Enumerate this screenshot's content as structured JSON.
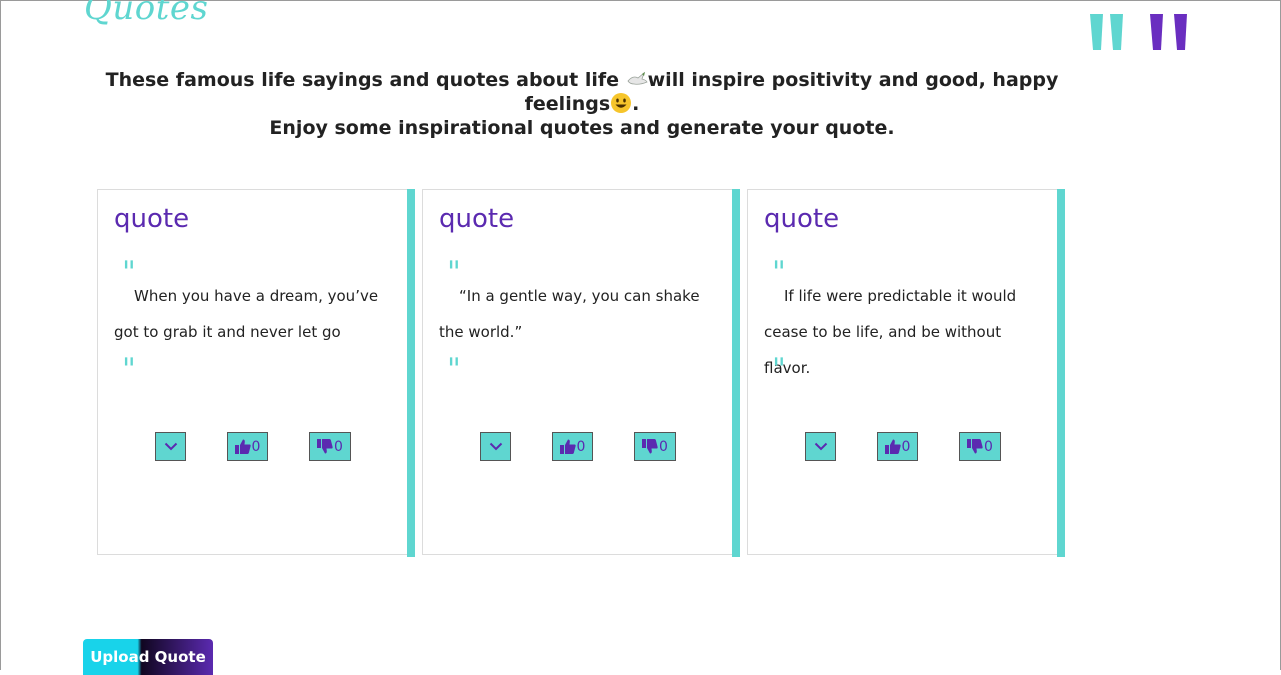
{
  "app": {
    "logo_text": "Quotes"
  },
  "intro": {
    "line1_part1": "These famous life sayings and quotes about life",
    "line1_part2": "will inspire positivity and good, happy feelings",
    "line1_end": ".",
    "line2": "Enjoy some inspirational quotes and generate your quote."
  },
  "cards": [
    {
      "title": "quote",
      "text": "When you have a dream, you’ve got to grab it and never let go",
      "likes": "0",
      "dislikes": "0"
    },
    {
      "title": "quote",
      "text": "“In a gentle way, you can shake the world.”",
      "likes": "0",
      "dislikes": "0"
    },
    {
      "title": "quote",
      "text": "If life were predictable it would cease to be life, and be without flavor.",
      "likes": "0",
      "dislikes": "0"
    }
  ],
  "quote_mark": "\"",
  "upload_button": {
    "label": "Upload Quote"
  },
  "icons": {
    "expand": "chevron-down-icon",
    "like": "thumbs-up-icon",
    "dislike": "thumbs-down-icon",
    "dove": "dove-emoji-icon",
    "smile": "smile-emoji-icon",
    "decor": "quote-marks-decor-icon"
  },
  "colors": {
    "accent": "#5fd6d0",
    "brand": "#5b2ab0"
  }
}
